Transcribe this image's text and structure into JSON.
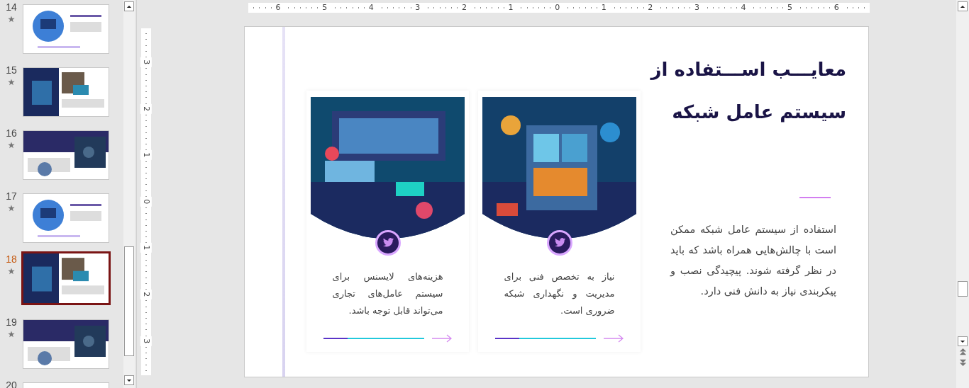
{
  "slide_panel": {
    "slides": [
      {
        "number": "14",
        "selected": false
      },
      {
        "number": "15",
        "selected": false
      },
      {
        "number": "16",
        "selected": false
      },
      {
        "number": "17",
        "selected": false
      },
      {
        "number": "18",
        "selected": true
      },
      {
        "number": "19",
        "selected": false
      },
      {
        "number": "20",
        "selected": false
      }
    ]
  },
  "rulers": {
    "horizontal": [
      "6",
      "5",
      "4",
      "3",
      "2",
      "1",
      "0",
      "1",
      "2",
      "3",
      "4",
      "5",
      "6"
    ],
    "vertical": [
      "3",
      "2",
      "1",
      "0",
      "1",
      "2",
      "3"
    ]
  },
  "slide": {
    "title": "معایـــب اســـتفاده از\nسیستم عامل شبکه",
    "body": "استفاده از سیستم عامل شبکه ممکن است با چالش‌هایی همراه باشد که باید در نظر گرفته شوند. پیچیدگی نصب و پیکربندی نیاز به دانش فنی دارد.",
    "cards": [
      {
        "text": "نیاز به تخصص فنی برای مدیریت و نگهداری شبکه ضروری است.",
        "level": 0.24
      },
      {
        "text": "هزینه‌های لایسنس برای سیستم عامل‌های تجاری می‌تواند قابل توجه باشد.",
        "level": 0.24
      }
    ]
  }
}
